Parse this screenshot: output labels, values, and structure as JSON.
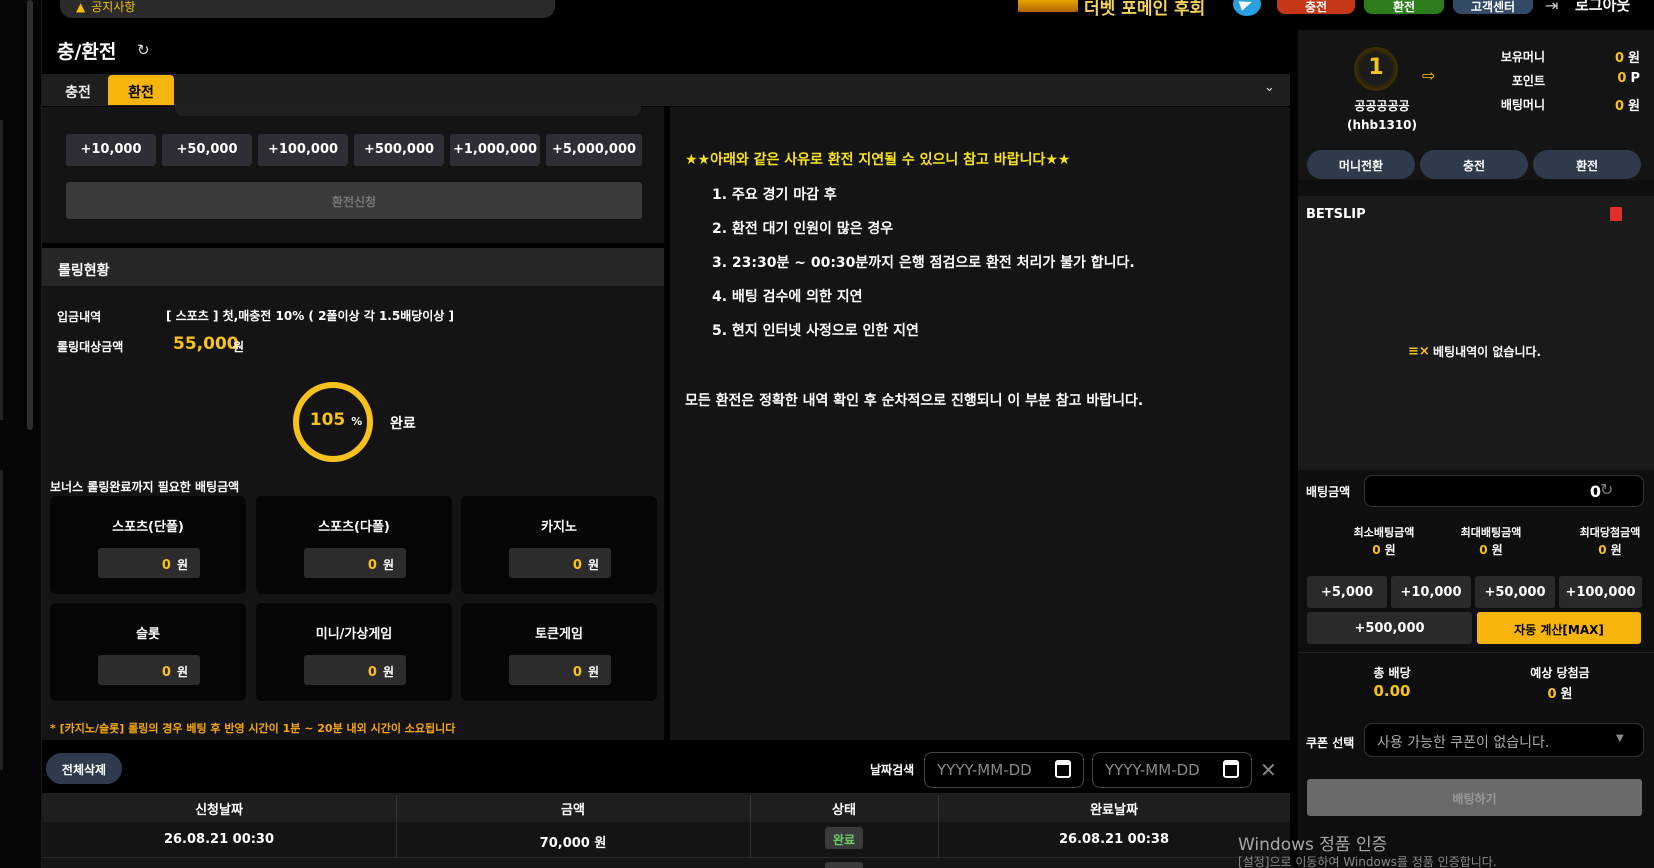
{
  "top": {
    "notice": "공지사항",
    "promo": "더벳 포메인 후회",
    "deposit": "충전",
    "withdraw": "환전",
    "support": "고객센터",
    "logout": "로그아웃"
  },
  "page": {
    "title": "충/환전"
  },
  "tabs": {
    "deposit": "충전",
    "withdraw": "환전"
  },
  "amount_buttons": [
    "+10,000",
    "+50,000",
    "+100,000",
    "+500,000",
    "+1,000,000",
    "+5,000,000"
  ],
  "submit_withdraw": "환전신청",
  "rolling": {
    "header": "롤링현황",
    "deposit_label": "입금내역",
    "deposit_value": "[ 스포츠 ] 첫,매충전 10% ( 2폴이상 각 1.5배당이상 ]",
    "target_label": "롤링대상금액",
    "target_amount": "55,000",
    "unit": "원",
    "progress_percent": 105,
    "progress_symbol": "%",
    "status": "완료",
    "bonus_title": "보너스 롤링완료까지 필요한 배팅금액",
    "cards": [
      {
        "name": "스포츠(단폴)",
        "value": "0",
        "unit": "원"
      },
      {
        "name": "스포츠(다폴)",
        "value": "0",
        "unit": "원"
      },
      {
        "name": "카지노",
        "value": "0",
        "unit": "원"
      },
      {
        "name": "슬롯",
        "value": "0",
        "unit": "원"
      },
      {
        "name": "미니/가상게임",
        "value": "0",
        "unit": "원"
      },
      {
        "name": "토큰게임",
        "value": "0",
        "unit": "원"
      }
    ],
    "note": "* [카지노/슬롯] 롤링의 경우 베팅 후 반영 시간이 1분 ~ 20분 내외 시간이 소요됩니다"
  },
  "info": {
    "heading": "★★아래와 같은 사유로 환전 지연될 수 있으니 참고 바랍니다★★",
    "items": [
      "1. 주요 경기 마감 후",
      "2. 환전 대기 인원이 많은 경우",
      "3. 23:30분 ~ 00:30분까지 은행 점검으로 환전 처리가 불가 합니다.",
      "4. 배팅 검수에 의한 지연",
      "5. 현지 인터넷 사정으로 인한 지연"
    ],
    "footer": "모든 환전은 정확한 내역 확인 후 순차적으로 진행되니 이 부분 참고 바랍니다."
  },
  "history": {
    "delete_all": "전체삭제",
    "date_search_label": "날짜검색",
    "date_placeholder": "YYYY-MM-DD",
    "columns": [
      "신청날짜",
      "금액",
      "상태",
      "완료날짜"
    ],
    "rows": [
      {
        "requested": "26.08.21 00:30",
        "amount": "70,000 원",
        "status": "완료",
        "completed": "26.08.21 00:38"
      }
    ]
  },
  "user": {
    "level": "1",
    "name": "공공공공공",
    "id": "(hhb1310)",
    "balance_label": "보유머니",
    "balance": "0",
    "balance_unit": "원",
    "point_label": "포인트",
    "point": "0",
    "point_unit": "P",
    "bet_money_label": "배팅머니",
    "bet_money": "0",
    "bet_money_unit": "원",
    "btn_money_transfer": "머니전환",
    "btn_deposit": "충전",
    "btn_withdraw": "환전"
  },
  "betslip": {
    "title": "BETSLIP",
    "empty": "베팅내역이 없습니다.",
    "amount_label": "배팅금액",
    "amount": "0",
    "min_label": "최소배팅금액",
    "max_label": "최대배팅금액",
    "max_win_label": "최대당첨금액",
    "min": "0",
    "max": "0",
    "max_win": "0",
    "unit": "원",
    "quick": [
      "+5,000",
      "+10,000",
      "+50,000",
      "+100,000",
      "+500,000"
    ],
    "auto_max": "자동 계산[MAX]",
    "total_odds_label": "총 배당",
    "total_odds": "0.00",
    "expected_label": "예상 당첨금",
    "expected": "0",
    "coupon_label": "쿠폰 선택",
    "coupon_value": "사용 가능한 쿠폰이 없습니다.",
    "submit": "배팅하기"
  },
  "watermark": {
    "line1": "Windows 정품 인증",
    "line2": "[설정]으로 이동하여 Windows를 정품 인증합니다."
  },
  "colors": {
    "accent": "#f7b50b",
    "highlight": "#f7c21c",
    "danger": "#c53616",
    "success": "#2d7c1d",
    "panel": "#141414"
  }
}
